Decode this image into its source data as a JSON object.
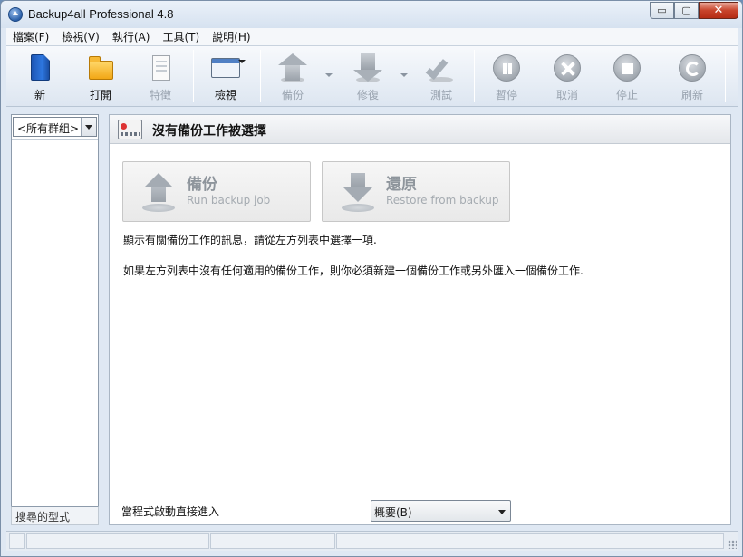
{
  "window": {
    "title": "Backup4all Professional 4.8",
    "minimize_label": "▭",
    "maximize_label": "▢",
    "close_label": "✕"
  },
  "menu": {
    "items": [
      "檔案(F)",
      "檢視(V)",
      "執行(A)",
      "工具(T)",
      "說明(H)"
    ]
  },
  "toolbar": {
    "new_label": "新",
    "open_label": "打開",
    "properties_label": "特徵",
    "view_label": "檢視",
    "backup_label": "備份",
    "restore_label": "修復",
    "test_label": "測試",
    "pause_label": "暫停",
    "cancel_label": "取消",
    "stop_label": "停止",
    "refresh_label": "刷新",
    "icons": {
      "new": "new-document-icon",
      "open": "folder-icon",
      "properties": "properties-icon",
      "view": "view-icon",
      "backup": "backup-icon",
      "restore": "restore-icon",
      "test": "checkmark-icon",
      "pause": "pause-icon",
      "cancel": "cancel-icon",
      "stop": "stop-icon",
      "refresh": "refresh-icon"
    }
  },
  "left_panel": {
    "group_filter": "<所有群組>",
    "search_type_label": "搜尋的型式"
  },
  "main": {
    "header_title": "沒有備份工作被選擇",
    "backup_button": {
      "title": "備份",
      "subtitle": "Run backup job"
    },
    "restore_button": {
      "title": "還原",
      "subtitle": "Restore from backup"
    },
    "info_line_1": "顯示有關備份工作的訊息，請從左方列表中選擇一項.",
    "info_line_2": "如果左方列表中沒有任何適用的備份工作，則你必須新建一個備份工作或另外匯入一個備份工作.",
    "startup_label": "當程式啟動直接進入",
    "startup_view_value": "概要(B)"
  },
  "colors": {
    "window_bg": "#dfe8f3",
    "disabled_text": "#9aa4b0",
    "close_button": "#c8442b"
  }
}
